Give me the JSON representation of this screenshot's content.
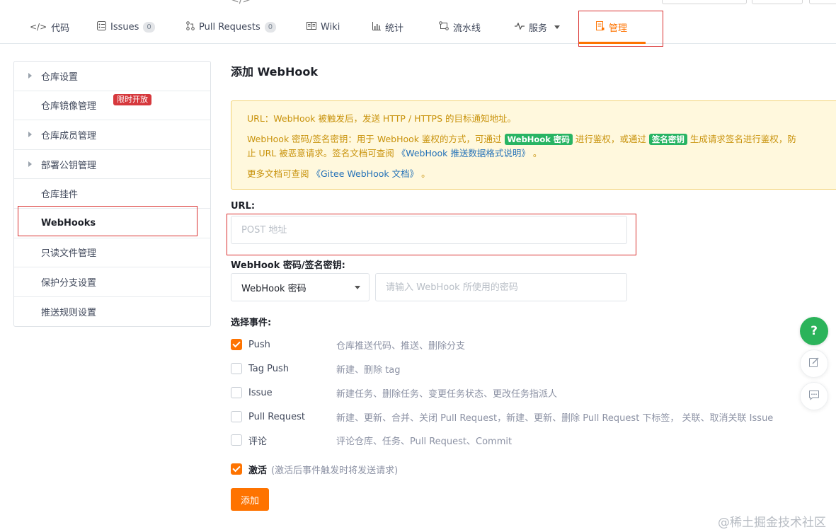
{
  "tabs": [
    {
      "label": "代码",
      "icon": "code-icon"
    },
    {
      "label": "Issues",
      "count": "0",
      "icon": "issues-icon"
    },
    {
      "label": "Pull Requests",
      "count": "0",
      "icon": "pull-request-icon"
    },
    {
      "label": "Wiki",
      "icon": "wiki-icon"
    },
    {
      "label": "统计",
      "icon": "stats-icon"
    },
    {
      "label": "流水线",
      "icon": "pipeline-icon"
    },
    {
      "label": "服务",
      "icon": "service-icon"
    },
    {
      "label": "管理",
      "icon": "manage-icon",
      "active": true
    }
  ],
  "sidebar": {
    "items": [
      {
        "label": "仓库设置",
        "expandable": true
      },
      {
        "label": "仓库镜像管理",
        "badge": "限时开放"
      },
      {
        "label": "仓库成员管理",
        "expandable": true
      },
      {
        "label": "部署公钥管理",
        "expandable": true
      },
      {
        "label": "仓库挂件"
      },
      {
        "label": "WebHooks",
        "active": true
      },
      {
        "label": "只读文件管理"
      },
      {
        "label": "保护分支设置"
      },
      {
        "label": "推送规则设置"
      }
    ]
  },
  "main": {
    "title": "添加 WebHook",
    "notice": {
      "line1": "URL：WebHook 被触发后，发送 HTTP / HTTPS 的目标通知地址。",
      "line2_a": "WebHook 密码/签名密钥：用于 WebHook 鉴权的方式，可通过",
      "line2_tag1": "WebHook 密码",
      "line2_b": "进行鉴权，或通过",
      "line2_tag2": "签名密钥",
      "line2_c": "生成请求签名进行鉴权，防",
      "line3_a": "止 URL 被恶意请求。签名文档可查阅",
      "line3_link": "《WebHook 推送数据格式说明》",
      "line3_b": "。",
      "line4_a": "更多文档可查阅",
      "line4_link": "《Gitee WebHook 文档》",
      "line4_b": "。"
    },
    "url_label": "URL:",
    "url_placeholder": "POST 地址",
    "url_value": "",
    "secret_label": "WebHook 密码/签名密钥:",
    "secret_type_selected": "WebHook 密码",
    "secret_placeholder": "请输入 WebHook 所使用的密码",
    "events_label": "选择事件:",
    "events": [
      {
        "name": "Push",
        "desc": "仓库推送代码、推送、删除分支",
        "checked": true
      },
      {
        "name": "Tag Push",
        "desc": "新建、删除 tag",
        "checked": false
      },
      {
        "name": "Issue",
        "desc": "新建任务、删除任务、变更任务状态、更改任务指派人",
        "checked": false
      },
      {
        "name": "Pull Request",
        "desc": "新建、更新、合并、关闭 Pull Request，新建、更新、删除 Pull Request 下标签， 关联、取消关联 Issue",
        "checked": false
      },
      {
        "name": "评论",
        "desc": "评论仓库、任务、Pull Request、Commit",
        "checked": false
      }
    ],
    "activate_label": "激活",
    "activate_hint": "(激活后事件触发时将发送请求)",
    "activate_checked": true,
    "add_button": "添加"
  },
  "float": {
    "help": "?",
    "icons": [
      "edit-icon",
      "comment-icon"
    ]
  },
  "watermark": "@稀土掘金技术社区"
}
